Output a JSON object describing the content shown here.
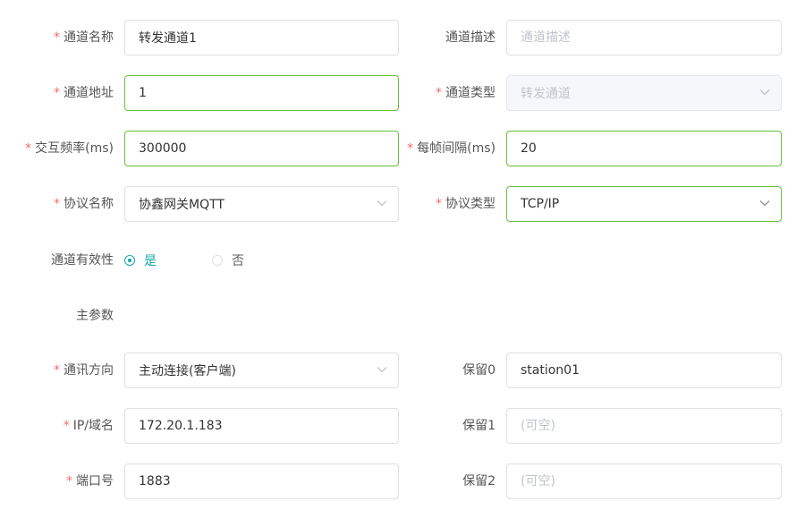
{
  "form": {
    "rows": [
      {
        "left": {
          "label": "通道名称",
          "required": true,
          "type": "input",
          "value": "转发通道1",
          "placeholder": ""
        },
        "right": {
          "label": "通道描述",
          "required": false,
          "type": "input",
          "value": "",
          "placeholder": "通道描述"
        }
      },
      {
        "left": {
          "label": "通道地址",
          "required": true,
          "type": "input",
          "value": "1",
          "placeholder": ""
        },
        "right": {
          "label": "通道类型",
          "required": true,
          "type": "select",
          "value": "转发通道",
          "placeholder": ""
        }
      },
      {
        "left": {
          "label": "交互频率(ms)",
          "required": true,
          "type": "input",
          "value": "300000",
          "placeholder": ""
        },
        "right": {
          "label": "每帧间隔(ms)",
          "required": true,
          "type": "input",
          "value": "20",
          "placeholder": ""
        }
      },
      {
        "left": {
          "label": "协议名称",
          "required": true,
          "type": "select",
          "value": "协鑫网关MQTT",
          "placeholder": ""
        },
        "right": {
          "label": "协议类型",
          "required": true,
          "type": "select",
          "value": "TCP/IP",
          "placeholder": ""
        }
      }
    ],
    "validity": {
      "label": "通道有效性",
      "options": [
        {
          "label": "是",
          "checked": true
        },
        {
          "label": "否",
          "checked": false
        }
      ]
    },
    "main_params_title": "主参数",
    "params": [
      {
        "left": {
          "label": "通讯方向",
          "required": true,
          "type": "select",
          "value": "主动连接(客户端)",
          "placeholder": ""
        },
        "right": {
          "label": "保留0",
          "required": false,
          "type": "input",
          "value": "station01",
          "placeholder": ""
        }
      },
      {
        "left": {
          "label": "IP/域名",
          "required": true,
          "type": "input",
          "value": "172.20.1.183",
          "placeholder": ""
        },
        "right": {
          "label": "保留1",
          "required": false,
          "type": "input",
          "value": "",
          "placeholder": "(可空)"
        }
      },
      {
        "left": {
          "label": "端口号",
          "required": true,
          "type": "input",
          "value": "1883",
          "placeholder": ""
        },
        "right": {
          "label": "保留2",
          "required": false,
          "type": "input",
          "value": "",
          "placeholder": "(可空)"
        }
      }
    ]
  },
  "colors": {
    "required_star": "#f56c6c",
    "focus_border": "#67c23a",
    "radio_checked": "#13a8a8"
  },
  "icons": {
    "select_arrow": "chevron-down-icon"
  }
}
